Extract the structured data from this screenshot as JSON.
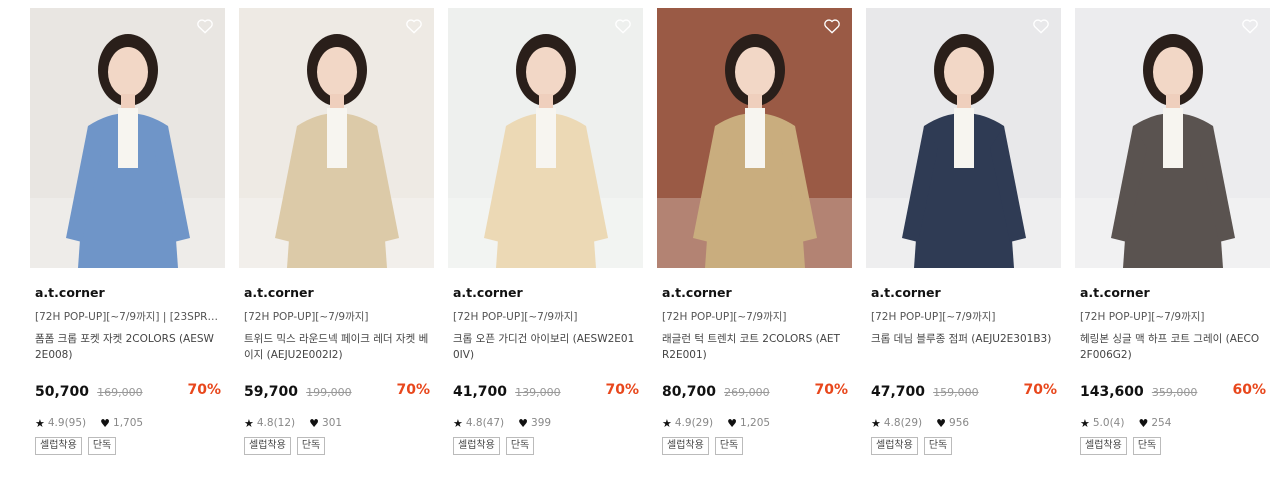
{
  "products": [
    {
      "brand": "a.t.corner",
      "tag": "[72H POP-UP][~7/9까지] | [23SPRI...",
      "title": "폼폼 크롭 포켓 자켓 2COLORS (AESW2E008)",
      "price": "50,700",
      "original_price": "169,000",
      "discount": "70%",
      "rating": "4.9(95)",
      "likes": "1,705",
      "badges": [
        "셀럽착용",
        "단독"
      ],
      "image_desc": "blue-cardigan-model",
      "bg_color": "#e9e6e2",
      "cloth_color": "#6f95c8"
    },
    {
      "brand": "a.t.corner",
      "tag": "[72H POP-UP][~7/9까지]",
      "title": "트위드 믹스 라운드넥 페이크 레더 자켓 베이지 (AEJU2E002I2)",
      "price": "59,700",
      "original_price": "199,000",
      "discount": "70%",
      "rating": "4.8(12)",
      "likes": "301",
      "badges": [
        "셀럽착용",
        "단독"
      ],
      "image_desc": "beige-leather-jacket-model",
      "bg_color": "#eeeae4",
      "cloth_color": "#dccaa8"
    },
    {
      "brand": "a.t.corner",
      "tag": "[72H POP-UP][~7/9까지]",
      "title": "크롭 오픈 가디건 아이보리 (AESW2E010IV)",
      "price": "41,700",
      "original_price": "139,000",
      "discount": "70%",
      "rating": "4.8(47)",
      "likes": "399",
      "badges": [
        "셀럽착용",
        "단독"
      ],
      "image_desc": "ivory-cardigan-model",
      "bg_color": "#eef0ee",
      "cloth_color": "#ecd9b5"
    },
    {
      "brand": "a.t.corner",
      "tag": "[72H POP-UP][~7/9까지]",
      "title": "래글런 턱 트렌치 코트 2COLORS (AETR2E001)",
      "price": "80,700",
      "original_price": "269,000",
      "discount": "70%",
      "rating": "4.9(29)",
      "likes": "1,205",
      "badges": [
        "셀럽착용",
        "단독"
      ],
      "image_desc": "trench-coat-model",
      "bg_color": "#9a5a45",
      "cloth_color": "#c9ad7e"
    },
    {
      "brand": "a.t.corner",
      "tag": "[72H POP-UP][~7/9까지]",
      "title": "크롭 데님 블루종 점퍼 (AEJU2E301B3)",
      "price": "47,700",
      "original_price": "159,000",
      "discount": "70%",
      "rating": "4.8(29)",
      "likes": "956",
      "badges": [
        "셀럽착용",
        "단독"
      ],
      "image_desc": "denim-jacket-model",
      "bg_color": "#e8e8ea",
      "cloth_color": "#2f3b54"
    },
    {
      "brand": "a.t.corner",
      "tag": "[72H POP-UP][~7/9까지]",
      "title": "헤링본 싱글 맥 하프 코트 그레이 (AECO2F006G2)",
      "price": "143,600",
      "original_price": "359,000",
      "discount": "60%",
      "rating": "5.0(4)",
      "likes": "254",
      "badges": [
        "셀럽착용",
        "단독"
      ],
      "image_desc": "grey-herringbone-coat-model",
      "bg_color": "#ececee",
      "cloth_color": "#5a5350"
    }
  ],
  "icons": {
    "wishlist": "heart-outline-icon",
    "rating": "star-icon",
    "likes": "heart-icon"
  },
  "colors": {
    "discount": "#e8471c",
    "text": "#222222",
    "muted": "#888888"
  }
}
